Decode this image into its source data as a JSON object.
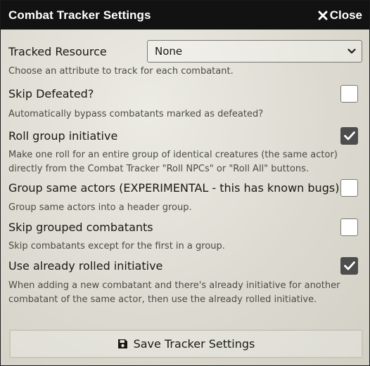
{
  "window": {
    "title": "Combat Tracker Settings",
    "close_label": "Close"
  },
  "settings": {
    "tracked_resource": {
      "label": "Tracked Resource",
      "selected": "None",
      "hint": "Choose an attribute to track for each combatant."
    },
    "skip_defeated": {
      "label": "Skip Defeated?",
      "checked": false,
      "hint": "Automatically bypass combatants marked as defeated?"
    },
    "roll_group_initiative": {
      "label": "Roll group initiative",
      "checked": true,
      "hint_line1": "Make one roll for an entire group of identical creatures (the same actor)",
      "hint_line2": "directly from the Combat Tracker \"Roll NPCs\" or \"Roll All\" buttons."
    },
    "group_same_actors": {
      "label": "Group same actors (EXPERIMENTAL - this has known bugs)",
      "checked": false,
      "hint": "Group same actors into a header group."
    },
    "skip_grouped": {
      "label": "Skip grouped combatants",
      "checked": false,
      "hint": "Skip combatants except for the first in a group."
    },
    "use_rolled_initiative": {
      "label": "Use already rolled initiative",
      "checked": true,
      "hint_line1": "When adding a new combatant and there's already initiative for another",
      "hint_line2": "combatant of the same actor, then use the already rolled initiative."
    }
  },
  "footer": {
    "save_label": "Save Tracker Settings",
    "save_icon": "floppy-disk-icon"
  },
  "colors": {
    "titlebar": "#121212",
    "checked_box": "#4d4d4d",
    "background": "#dddbd1"
  }
}
